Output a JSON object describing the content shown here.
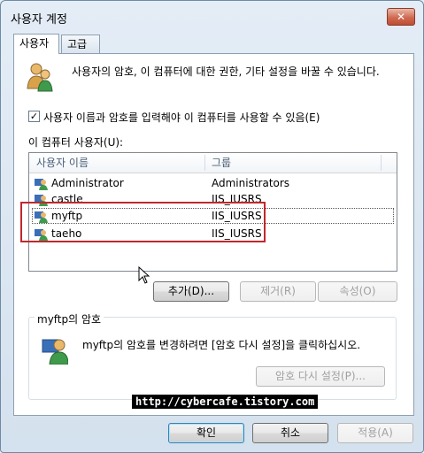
{
  "window": {
    "title": "사용자 계정",
    "close_label": "✕"
  },
  "tabs": [
    {
      "label": "사용자"
    },
    {
      "label": "고급"
    }
  ],
  "intro": {
    "text": "사용자의 암호, 이 컴퓨터에 대한  권한, 기타 설정을 바꿀 수 있습니다."
  },
  "require_login": {
    "label": "사용자 이름과 암호를 입력해야 이 컴퓨터를 사용할 수 있음(E)",
    "checked": true
  },
  "users_list": {
    "label": "이 컴퓨터 사용자(U):",
    "columns": [
      "사용자 이름",
      "그룹"
    ],
    "rows": [
      {
        "name": "Administrator",
        "group": "Administrators"
      },
      {
        "name": "castle",
        "group": "IIS_IUSRS"
      },
      {
        "name": "myftp",
        "group": "IIS_IUSRS"
      },
      {
        "name": "taeho",
        "group": "IIS_IUSRS"
      }
    ],
    "selected_index": 2
  },
  "list_buttons": {
    "add": "추가(D)...",
    "remove": "제거(R)",
    "properties": "속성(O)"
  },
  "password_group": {
    "title": "myftp의 암호",
    "text": "myftp의 암호를 변경하려면 [암호 다시 설정]을 클릭하십시오.",
    "reset_button": "암호 다시 설정(P)..."
  },
  "watermark": "http://cybercafe.tistory.com",
  "footer": {
    "ok": "확인",
    "cancel": "취소",
    "apply": "적용(A)"
  },
  "colors": {
    "highlight": "#c0282d",
    "icon_blue": "#3a6fb8",
    "icon_green": "#3f9a4c"
  }
}
